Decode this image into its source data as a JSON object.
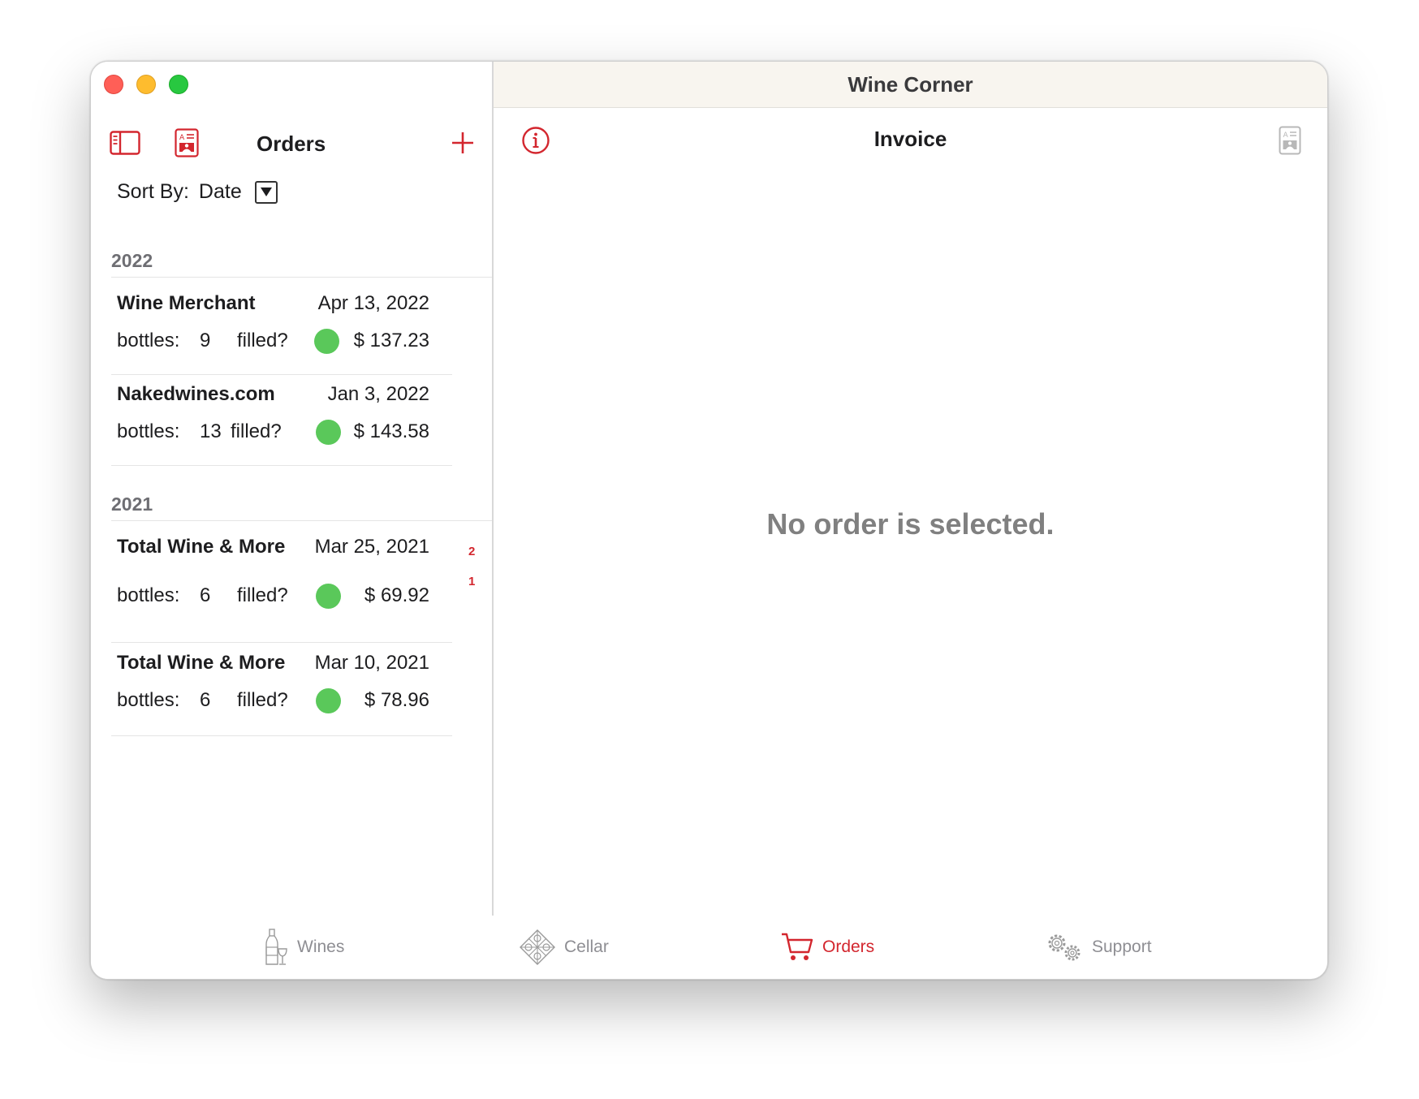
{
  "window": {
    "title": "Wine Corner"
  },
  "sidebar": {
    "title": "Orders",
    "sort": {
      "label": "Sort By:",
      "value": "Date"
    },
    "sections": [
      {
        "year": "2022",
        "orders": [
          {
            "vendor": "Wine Merchant",
            "date": "Apr 13, 2022",
            "bottles_label": "bottles:",
            "bottles": "9",
            "filled_label": "filled?",
            "filled": true,
            "price": "$  137.23"
          },
          {
            "vendor": "Nakedwines.com",
            "date": "Jan 3, 2022",
            "bottles_label": "bottles:",
            "bottles": "13",
            "filled_label": "filled?",
            "filled": true,
            "price": "$  143.58"
          }
        ]
      },
      {
        "year": "2021",
        "orders": [
          {
            "vendor": "Total Wine & More",
            "date": "Mar 25, 2021",
            "bottles_label": "bottles:",
            "bottles": "6",
            "filled_label": "filled?",
            "filled": true,
            "price": "$  69.92"
          },
          {
            "vendor": "Total Wine & More",
            "date": "Mar 10, 2021",
            "bottles_label": "bottles:",
            "bottles": "6",
            "filled_label": "filled?",
            "filled": true,
            "price": "$  78.96"
          }
        ]
      }
    ],
    "section_index": [
      "2",
      "1"
    ]
  },
  "detail": {
    "title": "Invoice",
    "empty_message": "No order is selected."
  },
  "tabs": [
    {
      "label": "Wines",
      "icon": "wine-bottle-icon",
      "active": false
    },
    {
      "label": "Cellar",
      "icon": "cellar-rack-icon",
      "active": false
    },
    {
      "label": "Orders",
      "icon": "cart-icon",
      "active": true
    },
    {
      "label": "Support",
      "icon": "gears-icon",
      "active": false
    }
  ],
  "colors": {
    "accent": "#d3262e",
    "filled_dot": "#5ac85a",
    "titlebar_bg": "#f8f5ef",
    "secondary_text": "#808080"
  }
}
